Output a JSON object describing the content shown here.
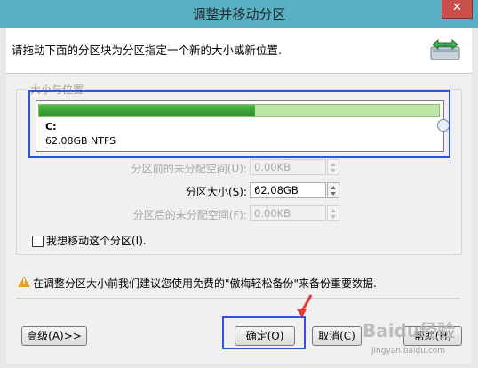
{
  "window": {
    "title": "调整并移动分区",
    "close_glyph": "✕"
  },
  "header": {
    "instruction": "请拖动下面的分区块为分区指定一个新的大小或新位置."
  },
  "group": {
    "legend": "大小与位置"
  },
  "disk": {
    "letter": "C:",
    "size_fs": "62.08GB NTFS",
    "used_fraction": 0.54,
    "bar_color": "#3aa33a"
  },
  "fields": {
    "before": {
      "label": "分区前的未分配空间(U):",
      "value": "0.00KB"
    },
    "size": {
      "label": "分区大小(S):",
      "value": "62.08GB"
    },
    "after": {
      "label": "分区后的未分配空间(F):",
      "value": "0.00KB"
    }
  },
  "move_checkbox": {
    "label": "我想移动这个分区(I).",
    "checked": false
  },
  "warning": {
    "text": "在调整分区大小前我们建议您使用免费的\"傲梅轻松备份\"来备份重要数据."
  },
  "buttons": {
    "advanced": "高级(A)>>",
    "ok": "确定(O)",
    "cancel": "取消(C)",
    "help": "帮助(H)"
  },
  "watermark": {
    "brand": "Baidu经验",
    "url": "jingyan.baidu.com"
  },
  "colors": {
    "titlebar": "#5ab0c3",
    "highlight": "#2f55d4",
    "warning": "#e6a020",
    "annotation_arrow": "#e53935"
  }
}
